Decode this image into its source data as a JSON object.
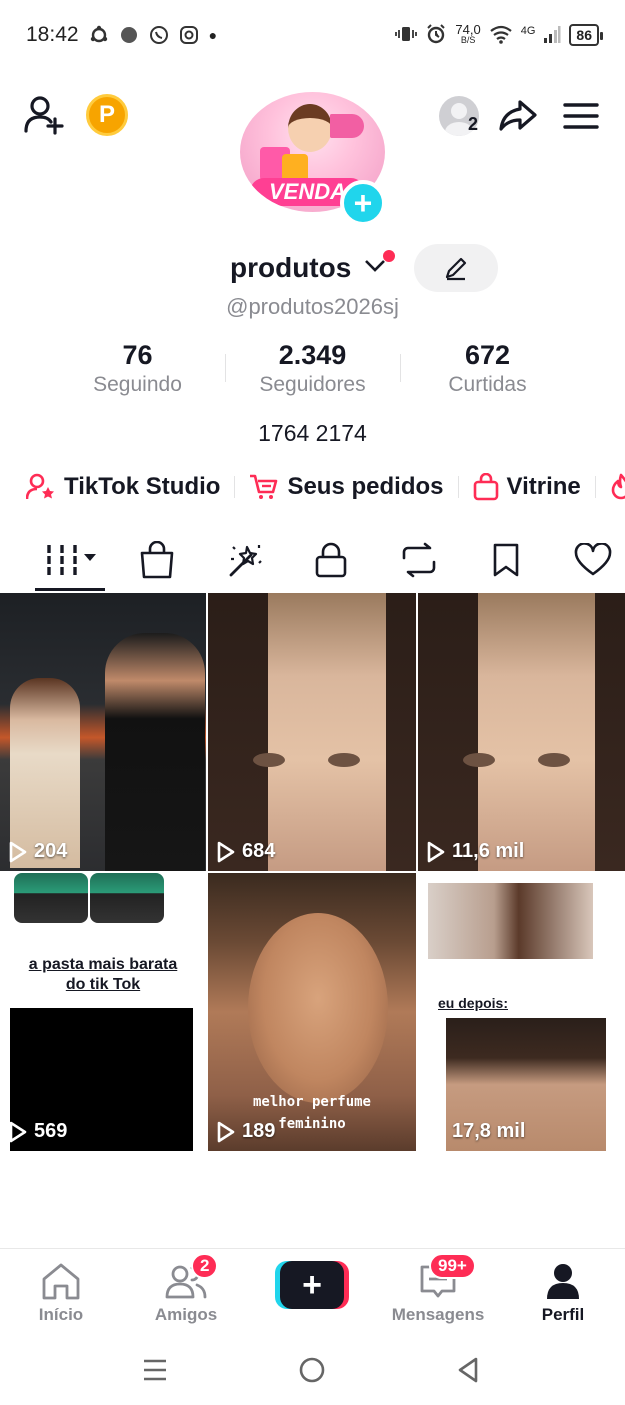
{
  "status_bar": {
    "time": "18:42",
    "net_speed_value": "74,0",
    "net_speed_unit": "B/S",
    "network": "4G",
    "battery": "86"
  },
  "header": {
    "avatar_banner": "VENDA",
    "viewer_count": "2"
  },
  "profile": {
    "username": "produtos",
    "handle": "@produtos2026sj",
    "stats": [
      {
        "value": "76",
        "label": "Seguindo"
      },
      {
        "value": "2.349",
        "label": "Seguidores"
      },
      {
        "value": "672",
        "label": "Curtidas"
      }
    ],
    "bio": "1764 2174"
  },
  "links": [
    {
      "label": "TikTok Studio"
    },
    {
      "label": "Seus pedidos"
    },
    {
      "label": "Vitrine"
    }
  ],
  "videos": [
    {
      "views": "204"
    },
    {
      "views": "684"
    },
    {
      "views": "11,6 mil"
    },
    {
      "views": "569",
      "caption_line1": "a pasta mais barata",
      "caption_line2": "do tik Tok"
    },
    {
      "views": "189",
      "caption_line1": "melhor perfume",
      "caption_line2": "feminino"
    },
    {
      "views": "17,8 mil",
      "caption": "eu depois:"
    }
  ],
  "bottom_nav": {
    "items": [
      {
        "label": "Início"
      },
      {
        "label": "Amigos",
        "badge": "2"
      },
      {
        "label": "Mensagens",
        "badge": "99+"
      },
      {
        "label": "Perfil"
      }
    ]
  },
  "colors": {
    "accent": "#fe2c55",
    "cyan": "#20d5ec",
    "text": "#161823",
    "secondary": "#8a8b91"
  }
}
